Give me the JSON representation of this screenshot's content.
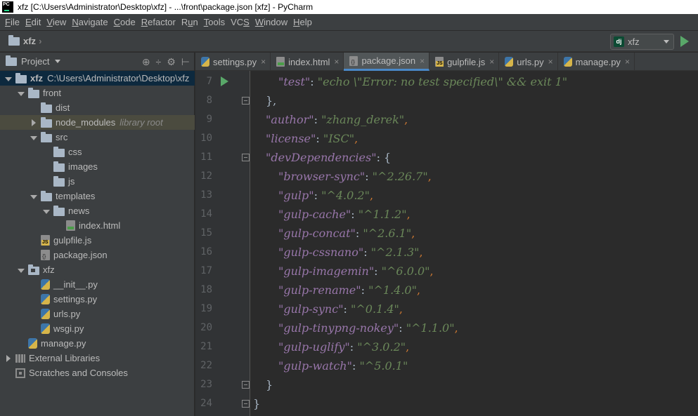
{
  "window": {
    "title": "xfz [C:\\Users\\Administrator\\Desktop\\xfz] - ...\\front\\package.json [xfz] - PyCharm"
  },
  "menu": [
    {
      "pre": "",
      "u": "F",
      "post": "ile"
    },
    {
      "pre": "",
      "u": "E",
      "post": "dit"
    },
    {
      "pre": "",
      "u": "V",
      "post": "iew"
    },
    {
      "pre": "",
      "u": "N",
      "post": "avigate"
    },
    {
      "pre": "",
      "u": "C",
      "post": "ode"
    },
    {
      "pre": "",
      "u": "R",
      "post": "efactor"
    },
    {
      "pre": "R",
      "u": "u",
      "post": "n"
    },
    {
      "pre": "",
      "u": "T",
      "post": "ools"
    },
    {
      "pre": "VC",
      "u": "S",
      "post": ""
    },
    {
      "pre": "",
      "u": "W",
      "post": "indow"
    },
    {
      "pre": "",
      "u": "H",
      "post": "elp"
    }
  ],
  "navbar": {
    "project": "xfz",
    "run_config": "xfz",
    "run_config_icon": "dj"
  },
  "project_panel": {
    "label": "Project"
  },
  "tree": [
    {
      "label": "xfz",
      "path": "C:\\Users\\Administrator\\Desktop\\xfz",
      "type": "folder",
      "depth": 0,
      "arrow": "down",
      "bold": true,
      "selected": true
    },
    {
      "label": "front",
      "type": "folder",
      "depth": 1,
      "arrow": "down"
    },
    {
      "label": "dist",
      "type": "folder",
      "depth": 2,
      "arrow": "none"
    },
    {
      "label": "node_modules",
      "note": "library root",
      "type": "folder",
      "depth": 2,
      "arrow": "right",
      "hl": true
    },
    {
      "label": "src",
      "type": "folder",
      "depth": 2,
      "arrow": "down"
    },
    {
      "label": "css",
      "type": "folder",
      "depth": 3,
      "arrow": "none"
    },
    {
      "label": "images",
      "type": "folder",
      "depth": 3,
      "arrow": "none"
    },
    {
      "label": "js",
      "type": "folder",
      "depth": 3,
      "arrow": "none"
    },
    {
      "label": "templates",
      "type": "folder",
      "depth": 2,
      "arrow": "down"
    },
    {
      "label": "news",
      "type": "folder",
      "depth": 3,
      "arrow": "down"
    },
    {
      "label": "index.html",
      "type": "html",
      "depth": 4,
      "arrow": "none"
    },
    {
      "label": "gulpfile.js",
      "type": "js",
      "depth": 2,
      "arrow": "none"
    },
    {
      "label": "package.json",
      "type": "json",
      "depth": 2,
      "arrow": "none"
    },
    {
      "label": "xfz",
      "type": "pkg",
      "depth": 1,
      "arrow": "down"
    },
    {
      "label": "__init__.py",
      "type": "py",
      "depth": 2,
      "arrow": "none"
    },
    {
      "label": "settings.py",
      "type": "py",
      "depth": 2,
      "arrow": "none"
    },
    {
      "label": "urls.py",
      "type": "py",
      "depth": 2,
      "arrow": "none"
    },
    {
      "label": "wsgi.py",
      "type": "py",
      "depth": 2,
      "arrow": "none"
    },
    {
      "label": "manage.py",
      "type": "py",
      "depth": 1,
      "arrow": "none"
    },
    {
      "label": "External Libraries",
      "type": "lib",
      "depth": 0,
      "arrow": "right"
    },
    {
      "label": "Scratches and Consoles",
      "type": "scratch",
      "depth": 0,
      "arrow": "none"
    }
  ],
  "tabs": [
    {
      "label": "settings.py",
      "type": "py",
      "active": false
    },
    {
      "label": "index.html",
      "type": "html",
      "active": false
    },
    {
      "label": "package.json",
      "type": "json",
      "active": true
    },
    {
      "label": "gulpfile.js",
      "type": "js",
      "active": false
    },
    {
      "label": "urls.py",
      "type": "py",
      "active": false
    },
    {
      "label": "manage.py",
      "type": "py",
      "active": false
    }
  ],
  "code": [
    {
      "n": "7",
      "indent": 2,
      "key": "test",
      "value": "echo \\\"Error: no test specified\\\" && exit 1",
      "tail": ""
    },
    {
      "n": "8",
      "indent": 1,
      "raw": "},"
    },
    {
      "n": "9",
      "indent": 1,
      "key": "author",
      "value": "zhang_derek",
      "tail": ","
    },
    {
      "n": "10",
      "indent": 1,
      "key": "license",
      "value": "ISC",
      "tail": ","
    },
    {
      "n": "11",
      "indent": 1,
      "key": "devDependencies",
      "open": "{"
    },
    {
      "n": "12",
      "indent": 2,
      "key": "browser-sync",
      "value": "^2.26.7",
      "tail": ","
    },
    {
      "n": "13",
      "indent": 2,
      "key": "gulp",
      "value": "^4.0.2",
      "tail": ","
    },
    {
      "n": "14",
      "indent": 2,
      "key": "gulp-cache",
      "value": "^1.1.2",
      "tail": ","
    },
    {
      "n": "15",
      "indent": 2,
      "key": "gulp-concat",
      "value": "^2.6.1",
      "tail": ","
    },
    {
      "n": "16",
      "indent": 2,
      "key": "gulp-cssnano",
      "value": "^2.1.3",
      "tail": ","
    },
    {
      "n": "17",
      "indent": 2,
      "key": "gulp-imagemin",
      "value": "^6.0.0",
      "tail": ","
    },
    {
      "n": "18",
      "indent": 2,
      "key": "gulp-rename",
      "value": "^1.4.0",
      "tail": ","
    },
    {
      "n": "19",
      "indent": 2,
      "key": "gulp-sync",
      "value": "^0.1.4",
      "tail": ","
    },
    {
      "n": "20",
      "indent": 2,
      "key": "gulp-tinypng-nokey",
      "value": "^1.1.0",
      "tail": ","
    },
    {
      "n": "21",
      "indent": 2,
      "key": "gulp-uglify",
      "value": "^3.0.2",
      "tail": ","
    },
    {
      "n": "22",
      "indent": 2,
      "key": "gulp-watch",
      "value": "^5.0.1",
      "tail": ""
    },
    {
      "n": "23",
      "indent": 1,
      "raw": "}"
    },
    {
      "n": "24",
      "indent": 0,
      "raw": "}"
    }
  ],
  "colors": {
    "key": "#9876aa",
    "string": "#6a8759",
    "punct": "#cc7832",
    "selection": "#0d293e",
    "accent": "#4a88c7",
    "run": "#59a869"
  }
}
